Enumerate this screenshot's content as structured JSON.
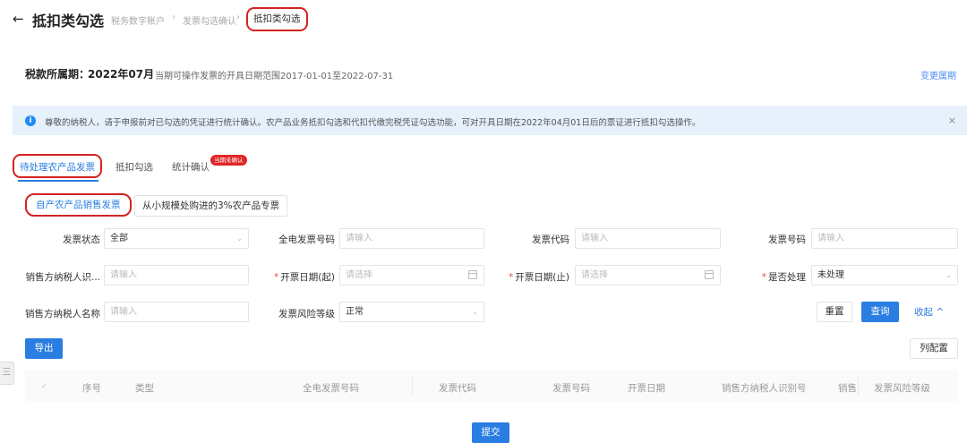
{
  "header": {
    "back_icon": "arrow-left-icon",
    "title": "抵扣类勾选",
    "breadcrumb": [
      "税务数字账户",
      "发票勾选确认",
      "抵扣类勾选"
    ],
    "breadcrumb_sep": "›"
  },
  "period": {
    "label": "税款所属期：",
    "value": "2022年07月",
    "description": "当期可操作发票的开具日期范围2017-01-01至2022-07-31",
    "change_link": "变更属期"
  },
  "notice": {
    "icon": "info-icon",
    "icon_glyph": "i",
    "text": "尊敬的纳税人，请于申报前对已勾选的凭证进行统计确认。农产品业务抵扣勾选和代扣代缴完税凭证勾选功能，可对开具日期在2022年04月01日后的票证进行抵扣勾选操作。",
    "close": "×"
  },
  "tabs": {
    "items": [
      "待处理农产品发票",
      "抵扣勾选",
      "统计确认"
    ],
    "active_index": 0,
    "badge": "当期未确认"
  },
  "subtabs": {
    "items": [
      "自产农产品销售发票",
      "从小规模处购进的3%农产品专票"
    ],
    "active_index": 0
  },
  "form": {
    "invoice_status": {
      "label": "发票状态",
      "value": "全部"
    },
    "e_invoice_no": {
      "label": "全电发票号码",
      "placeholder": "请输入"
    },
    "invoice_code": {
      "label": "发票代码",
      "placeholder": "请输入"
    },
    "invoice_no": {
      "label": "发票号码",
      "placeholder": "请输入"
    },
    "seller_tax_id": {
      "label": "销售方纳税人识...",
      "placeholder": "请输入"
    },
    "date_start": {
      "label": "开票日期(起)",
      "placeholder": "请选择",
      "required_mark": "*"
    },
    "date_end": {
      "label": "开票日期(止)",
      "placeholder": "请选择",
      "required_mark": "*"
    },
    "processed": {
      "label": "是否处理",
      "value": "未处理",
      "required_mark": "*"
    },
    "seller_name": {
      "label": "销售方纳税人名称",
      "placeholder": "请输入"
    },
    "risk_level": {
      "label": "发票风险等级",
      "value": "正常"
    },
    "chevron": "⌄"
  },
  "actions": {
    "reset": "重置",
    "query": "查询",
    "collapse": "收起 ^",
    "export": "导出",
    "columns": "列配置",
    "submit": "提交"
  },
  "table": {
    "side_icon": "三",
    "check": "✓",
    "columns": [
      "序号",
      "类型",
      "全电发票号码",
      "发票代码",
      "发票号码",
      "开票日期",
      "销售方纳税人识别号",
      "销售",
      "发票风险等级"
    ]
  },
  "colors": {
    "primary": "#2a7de1",
    "highlight_border": "#d42222",
    "notice_bg": "#e6f1fc",
    "badge": "#e02525"
  }
}
